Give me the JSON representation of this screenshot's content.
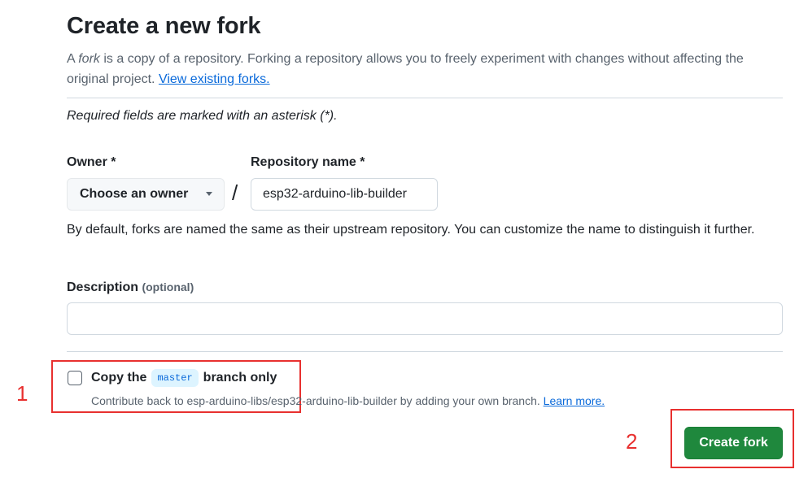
{
  "page": {
    "title": "Create a new fork",
    "intro": {
      "prefix": "A ",
      "fork_word": "fork",
      "text": " is a copy of a repository. Forking a repository allows you to freely experiment with changes without affecting the original project. ",
      "link": "View existing forks."
    },
    "required_note": "Required fields are marked with an asterisk (*)."
  },
  "form": {
    "owner_label": "Owner *",
    "owner_button": "Choose an owner",
    "separator": "/",
    "repo_label": "Repository name *",
    "repo_value": "esp32-arduino-lib-builder",
    "name_hint": "By default, forks are named the same as their upstream repository. You can customize the name to distinguish it further.",
    "description_label": "Description",
    "description_optional": "(optional)",
    "description_value": ""
  },
  "branch_option": {
    "label_prefix": "Copy the",
    "branch_name": "master",
    "label_suffix": "branch only",
    "checked": false,
    "note": "Contribute back to esp-arduino-libs/esp32-arduino-lib-builder by adding your own branch. ",
    "learn_more": "Learn more."
  },
  "actions": {
    "create_fork": "Create fork"
  },
  "annotations": {
    "marker_1": "1",
    "marker_2": "2",
    "color": "#e8302f"
  },
  "colors": {
    "primary_button": "#1f883d",
    "link": "#0969da",
    "muted_text": "#59636e",
    "branch_badge_bg": "#ddf4ff"
  }
}
